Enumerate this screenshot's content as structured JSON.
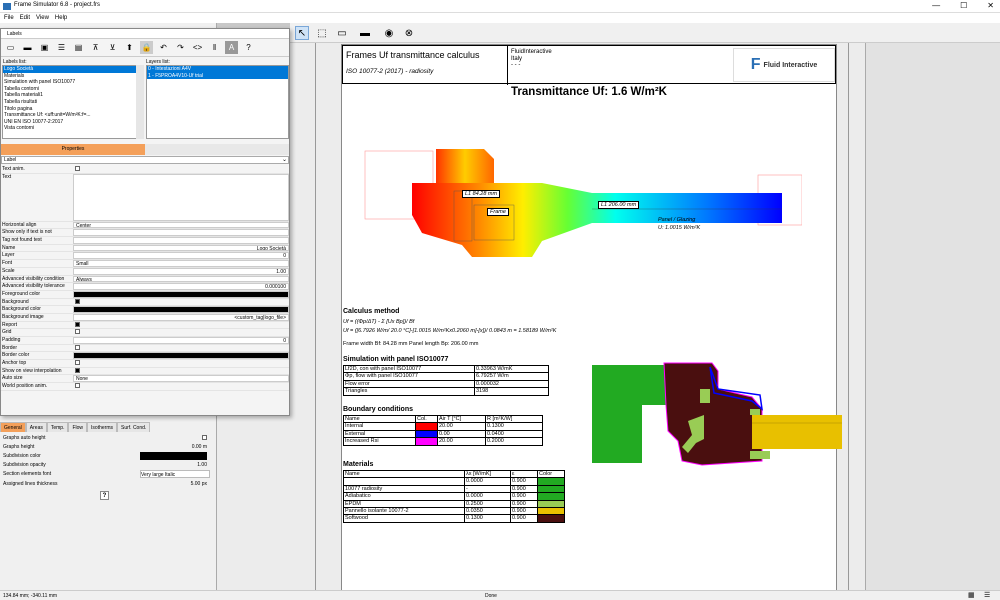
{
  "window": {
    "title": "Frame Simulator 6.8 - project.frs",
    "buttons": [
      "—",
      "☐",
      "✕"
    ]
  },
  "menu": [
    "File",
    "Edit",
    "View",
    "Help"
  ],
  "labels_window": {
    "title": "Labels",
    "labels_list_title": "Labels list:",
    "layers_list_title": "Layers list:",
    "labels": [
      "Logo Società",
      "Materials",
      "Simulation with panel ISO10077",
      "Tabella contorni",
      "Tabella materiali1",
      "Tabella risultati",
      "Titolo pagina",
      "Transmittance Uf: <uff:unit=W/m²K:f=...",
      "UNI EN ISO 10077-2:2017",
      "Vista contorni"
    ],
    "layers": [
      "0 - Intestazioni A4V",
      "1 - F5PROA4V10-Uf trial"
    ],
    "tab_properties": "Properties",
    "type_value": "Label",
    "props": [
      {
        "n": "Text anim.",
        "v": "",
        "t": "cb"
      },
      {
        "n": "Text",
        "v": "",
        "t": "text"
      },
      {
        "n": "Horizontal align",
        "v": "Center",
        "t": "select"
      },
      {
        "n": "Show only if text is not",
        "v": "",
        "t": "input"
      },
      {
        "n": "Tag not found text",
        "v": "",
        "t": "input"
      },
      {
        "n": "Name",
        "v": "Logo Società",
        "t": "right"
      },
      {
        "n": "Layer",
        "v": "0",
        "t": "right"
      },
      {
        "n": "Font",
        "v": "Small",
        "t": "input"
      },
      {
        "n": "Scale",
        "v": "1.00",
        "t": "right"
      },
      {
        "n": "Advanced visibility condition",
        "v": "Always",
        "t": "select"
      },
      {
        "n": "Advanced visibility tolerance",
        "v": "0.000100",
        "t": "right"
      },
      {
        "n": "Foreground color",
        "v": "",
        "t": "black"
      },
      {
        "n": "Background",
        "v": "",
        "t": "cbon"
      },
      {
        "n": "Background color",
        "v": "",
        "t": "black"
      },
      {
        "n": "Background image",
        "v": "<custom_tag|logo_file>",
        "t": "right"
      },
      {
        "n": "Report",
        "v": "",
        "t": "cbon"
      },
      {
        "n": "Grid",
        "v": "",
        "t": "cb"
      },
      {
        "n": "Padding",
        "v": "0",
        "t": "right"
      },
      {
        "n": "Border",
        "v": "",
        "t": "cb"
      },
      {
        "n": "Border color",
        "v": "",
        "t": "black"
      },
      {
        "n": "Anchor top",
        "v": "",
        "t": "cb"
      },
      {
        "n": "Show on view interpolation",
        "v": "",
        "t": "cbon"
      },
      {
        "n": "Auto size",
        "v": "None",
        "t": "select"
      },
      {
        "n": "World position anim.",
        "v": "",
        "t": "cb"
      }
    ]
  },
  "graph_tabs": [
    "General",
    "Areas",
    "Temp.",
    "Flow",
    "Isotherms",
    "Surf. Cond."
  ],
  "graph_props": [
    {
      "n": "Graphs auto height",
      "v": ""
    },
    {
      "n": "Graphs height",
      "v": "0.00 m"
    },
    {
      "n": "Subdivision color",
      "v": ""
    },
    {
      "n": "Subdivision opacity",
      "v": "1.00"
    },
    {
      "n": "Section elements font",
      "v": "Very large Italic"
    },
    {
      "n": "Assigned lines thickness",
      "v": "5.00 px"
    }
  ],
  "help_btn": "?",
  "status": {
    "coords": "134.84 mm; -340.11 mm",
    "center": "Done"
  },
  "report": {
    "header_title": "Frames Uf transmittance calculus",
    "header_std": "ISO 10077-2 (2017) - radiosity",
    "company": "FluidInteractive",
    "country": "Italy",
    "dashes": "- - -",
    "logo_text": "Fluid Interactive",
    "main_title": "Transmittance Uf: 1.6 W/m²K",
    "dim1": "L1 84.28 mm",
    "dim2": "L1 206.00 mm",
    "frame_lbl": "Frame",
    "panel_lbl": "Panel / Glazing",
    "u_lbl": "U: 1.0015 W/m²K",
    "calc_title": "Calculus method",
    "calc_f1": "Uf = ((Φp/ΔT) - Σ [Ux Bp])/ Bf",
    "calc_f2": "Uf = ([6.7926 W/m/ 20.0 °C]-[1.0015 W/m²Kx0.2060 m]-[x])/ 0.0843 m = 1.58189 W/m²K",
    "calc_f3": "Frame width Bf: 84.28 mm     Panel length Bp: 206.00 mm",
    "sim_title": "Simulation with panel ISO10077",
    "sim_rows": [
      [
        "Lf2D, con with panel ISO10077",
        "0.33963 W/mK"
      ],
      [
        "Φp, flow with panel ISO10077",
        "6.79257 W/m"
      ],
      [
        "Flow error",
        "0.000032"
      ],
      [
        "Triangles",
        "3198"
      ]
    ],
    "bc_title": "Boundary conditions",
    "bc_head": [
      "Name",
      "Col.",
      "Air T [°C]",
      "R [m²K/W]"
    ],
    "bc_rows": [
      [
        "Internal",
        "#ff0000",
        "20.00",
        "0.1300"
      ],
      [
        "External",
        "#0000ff",
        "0.00",
        "0.0400"
      ],
      [
        "Increased Rsi",
        "#ff00ff",
        "20.00",
        "0.2000"
      ]
    ],
    "mat_title": "Materials",
    "mat_head": [
      "Name",
      "λx [W/mK]",
      "ε",
      "Color"
    ],
    "mat_rows": [
      [
        "",
        "0.0000",
        "0.900",
        "#22aa22"
      ],
      [
        "10077 radiosity",
        "-",
        "0.900",
        "#22aa22"
      ],
      [
        "Adiabatico",
        "0.0000",
        "0.900",
        "#22aa22"
      ],
      [
        "EPDM",
        "0.2500",
        "0.900",
        "#99cc55"
      ],
      [
        "Pannello isolante 10077-2",
        "0.0350",
        "0.900",
        "#e8c000"
      ],
      [
        "Softwood",
        "0.1300",
        "0.900",
        "#4a0f0f"
      ]
    ]
  }
}
